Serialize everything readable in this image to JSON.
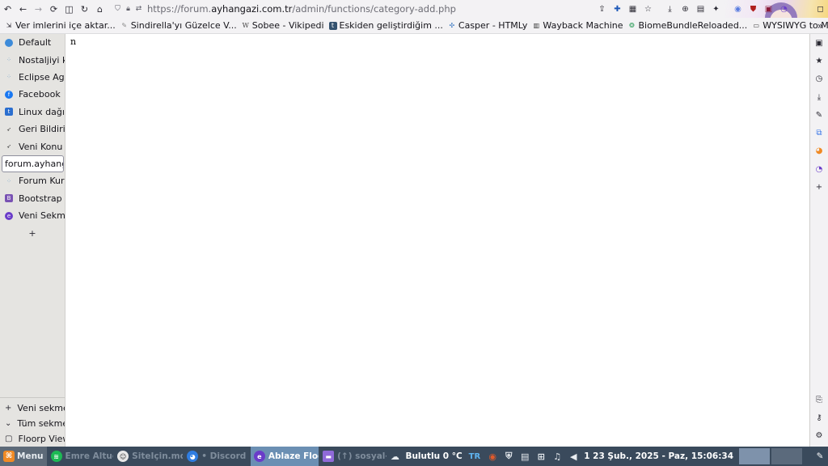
{
  "toolbar": {
    "url_prefix": "https://forum.",
    "url_domain": "ayhangazi.com.tr",
    "url_path": "/admin/functions/category-add.php"
  },
  "bookmarks": [
    {
      "label": "Ver imlerini içe aktar...",
      "icon": "import-icon",
      "color": "#2b2a33"
    },
    {
      "label": "Sindirella'yı Güzelce V...",
      "icon": "feather-icon",
      "color": "#8a8a8a"
    },
    {
      "label": "Sobee - Vikipedi",
      "icon": "wikipedia-icon",
      "color": "#5a5a5a"
    },
    {
      "label": "Eskiden geliştirdiğim ...",
      "icon": "tumblr-icon",
      "color": "#34526f"
    },
    {
      "label": "Casper - HTMLy",
      "icon": "puzzle-icon",
      "color": "#3b78c2"
    },
    {
      "label": "Wayback Machine",
      "icon": "archive-icon",
      "color": "#333333"
    },
    {
      "label": "BiomeBundleReloaded...",
      "icon": "biome-icon",
      "color": "#2f9e5b"
    },
    {
      "label": "WYSIWYG to Markdown",
      "icon": "markdown-icon",
      "color": "#444444"
    }
  ],
  "sidebar": {
    "tabs": [
      {
        "label": "Default",
        "icon": "globe-icon",
        "color": "#3d8bd9"
      },
      {
        "label": "Nostaljiyi ko",
        "icon": "dots-icon",
        "color": "#6aa0c8"
      },
      {
        "label": "Eclipse Agen",
        "icon": "dots-icon",
        "color": "#6aa0c8"
      },
      {
        "label": "Facebook",
        "icon": "facebook-icon",
        "color": "#1877f2"
      },
      {
        "label": "Linux dağıtı",
        "icon": "tumblr-icon",
        "color": "#2a6ecf"
      },
      {
        "label": "Geri Bildirim",
        "icon": "rocket-icon",
        "color": "#3a3a3a"
      },
      {
        "label": "Veni Konu -",
        "icon": "rocket-icon",
        "color": "#3a3a3a"
      },
      {
        "label": "forum.ayhanga",
        "icon": "none",
        "color": "#ffffff",
        "active": true
      },
      {
        "label": "Forum Kura",
        "icon": "dots-icon",
        "color": "#6aa0c8"
      },
      {
        "label": "Bootstrap I",
        "icon": "bootstrap-icon",
        "color": "#7952b3"
      },
      {
        "label": "Veni Sekme",
        "icon": "floorp-icon",
        "color": "#6a3cc9"
      }
    ],
    "add_label": "+",
    "bottom": [
      {
        "label": "Veni sekme",
        "icon": "+"
      },
      {
        "label": "Tüm sekme",
        "icon": "⌄"
      },
      {
        "label": "Floorp View",
        "icon": "▢"
      }
    ]
  },
  "content": {
    "text": "n"
  },
  "taskbar": {
    "menu_label": "Menu",
    "tasks": [
      {
        "label": "Emre Altuğ - ...",
        "icon": "spotify-icon",
        "color": "#1db954"
      },
      {
        "label": "SiteIçin.md - ...",
        "icon": "ghost-icon",
        "color": "#e8e8e8"
      },
      {
        "label": "• Discord | #...",
        "icon": "firefox-icon",
        "color": "#2f7de1"
      },
      {
        "label": "Ablaze Floorp",
        "icon": "floorp-icon",
        "color": "#6a3cc9",
        "active": true
      },
      {
        "label": "(↑) sosyal-se...",
        "icon": "folder-icon",
        "color": "#8f6ad8"
      }
    ],
    "weather": "Bulutlu 0 °C",
    "lang": "TR",
    "clock": "1 23 Şub., 2025 - Paz, 15:06:34"
  },
  "colors": {
    "taskbar_bg": "#3a4a5c",
    "active_task": "#6b8fb3",
    "sidebar_bg": "#e5e4e1"
  }
}
